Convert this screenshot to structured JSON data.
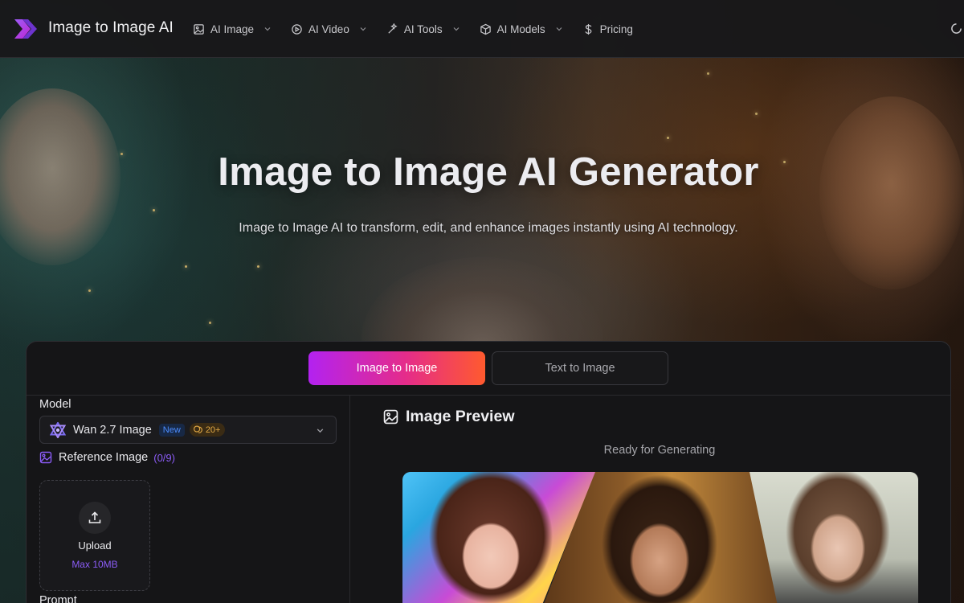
{
  "header": {
    "brand": "Image to Image AI",
    "nav": [
      {
        "label": "AI Image",
        "icon": "image-icon",
        "has_dropdown": true
      },
      {
        "label": "AI Video",
        "icon": "play-circle-icon",
        "has_dropdown": true
      },
      {
        "label": "AI Tools",
        "icon": "magic-wand-icon",
        "has_dropdown": true
      },
      {
        "label": "AI Models",
        "icon": "cube-icon",
        "has_dropdown": true
      },
      {
        "label": "Pricing",
        "icon": "dollar-icon",
        "has_dropdown": false
      }
    ]
  },
  "hero": {
    "title": "Image to Image AI Generator",
    "subtitle": "Image to Image AI to transform, edit, and enhance images instantly using AI technology."
  },
  "generator": {
    "tabs": [
      {
        "label": "Image to Image",
        "active": true
      },
      {
        "label": "Text to Image",
        "active": false
      }
    ],
    "model_label": "Model",
    "model": {
      "name": "Wan 2.7 Image",
      "badge_new": "New",
      "credits": "20+"
    },
    "reference_label": "Reference Image",
    "reference_count": "(0/9)",
    "upload": {
      "label": "Upload",
      "limit": "Max 10MB"
    },
    "prompt_label": "Prompt"
  },
  "preview": {
    "title": "Image Preview",
    "status": "Ready for Generating"
  },
  "colors": {
    "accent_gradient_start": "#b322f0",
    "accent_gradient_mid": "#e52c8a",
    "accent_gradient_end": "#ff5a2e",
    "accent_purple": "#8b5cf6",
    "badge_new": "#4c8dff",
    "credits": "#e2a945"
  }
}
